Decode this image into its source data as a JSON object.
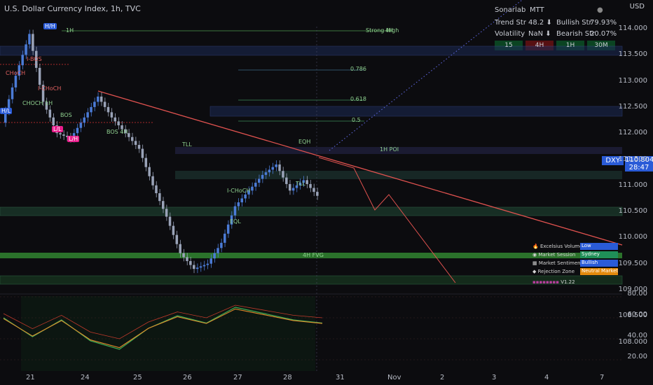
{
  "header": {
    "symbol": "U.S. Dollar Currency Index, 1h, TVC",
    "currency": "USD"
  },
  "panel": {
    "title": "Sonarlab",
    "mode": "MTT",
    "rows": [
      {
        "k1": "Trend Str",
        "v1": "48.2 ⬇",
        "k2": "Bullish Str",
        "v2": "79.93%"
      },
      {
        "k1": "Volatility",
        "v1": "NaN ⬇",
        "k2": "Bearish Str",
        "v2": "20.07%"
      }
    ],
    "timeframes": [
      "15",
      "4H",
      "1H",
      "30M"
    ],
    "tf_colors": [
      "#0c6b2e",
      "#8b1414",
      "#0c6b2e",
      "#0c6b2e"
    ]
  },
  "price": {
    "symbol": "DXY",
    "last": "110.804",
    "countdown": "28:47"
  },
  "legend": [
    {
      "icon": "flame-icon",
      "label": "Excelsius Volume",
      "value": "Low",
      "color": "#2a5bd7"
    },
    {
      "icon": "globe-icon",
      "label": "Market Session",
      "value": "Sydney",
      "color": "#1f8f58"
    },
    {
      "icon": "chart-icon",
      "label": "Market Sentiment",
      "value": "Bullish",
      "color": "#2a5bd7"
    },
    {
      "icon": "shield-icon",
      "label": "Rejection Zone",
      "value": "Neutral Market",
      "color": "#e38a0c"
    }
  ],
  "version": "V1.22",
  "annotations": [
    "H/H",
    "1H",
    "4H",
    "Strong High",
    "I-BOS",
    "CHoCH",
    "I-CHoCH",
    "CHOCH 1H",
    "BOS",
    "H/L",
    "L/L",
    "L/H",
    "BOS 4H",
    "TLL",
    "EQH",
    "EQL",
    "I-CHoCH",
    "1H POI",
    "4H FVG",
    "0.786",
    "0.618",
    "0.5",
    "TLL"
  ],
  "chart_data": {
    "type": "line",
    "y_ticks": [
      114.0,
      113.5,
      113.0,
      112.5,
      112.0,
      111.5,
      111.0,
      110.5,
      110.0,
      109.5,
      109.0,
      108.5,
      108.0
    ],
    "osc_ticks": [
      80.0,
      60.0,
      40.0,
      20.0
    ],
    "x_ticks": [
      "21",
      "24",
      "25",
      "26",
      "27",
      "28",
      "31",
      "Nov",
      "2",
      "3",
      "4",
      "7"
    ],
    "ylim": [
      107.7,
      114.4
    ],
    "price_series": {
      "x": [
        "21",
        "21",
        "21",
        "21",
        "24",
        "24",
        "24",
        "24",
        "25",
        "25",
        "25",
        "26",
        "26",
        "26",
        "26",
        "27",
        "27",
        "27",
        "27",
        "28",
        "28",
        "28",
        "28",
        "28"
      ],
      "close": [
        112.2,
        113.1,
        113.9,
        112.6,
        112.0,
        111.9,
        112.3,
        112.7,
        112.3,
        112.0,
        111.7,
        111.0,
        110.4,
        109.7,
        109.4,
        109.5,
        109.9,
        110.6,
        110.9,
        111.2,
        111.4,
        110.9,
        111.1,
        110.8
      ]
    },
    "oscillator": {
      "x": [
        "21",
        "24",
        "25",
        "26",
        "27",
        "28"
      ],
      "values": [
        60,
        42,
        58,
        38,
        30,
        50,
        62,
        55,
        70,
        64,
        58,
        55
      ]
    }
  }
}
